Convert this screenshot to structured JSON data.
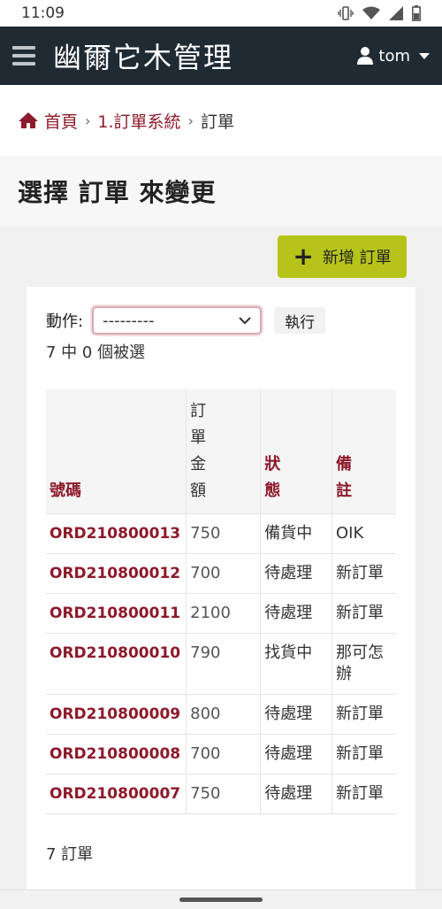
{
  "status_bar": {
    "time": "11:09"
  },
  "app_bar": {
    "title": "幽爾它木管理",
    "user": "tom"
  },
  "breadcrumbs": {
    "home": "首頁",
    "section": "1.訂單系統",
    "current": "訂單"
  },
  "page": {
    "title": "選擇 訂單 來變更",
    "add_button": "新增 訂單"
  },
  "actions": {
    "label": "動作:",
    "selected": "---------",
    "go_button": "執行",
    "counter": "7 中 0 個被選"
  },
  "table": {
    "headers": {
      "number": "號碼",
      "amount": "訂\n單\n金\n額",
      "status": "狀\n態",
      "note": "備\n註"
    },
    "rows": [
      {
        "id": "ORD210800013",
        "amount": "750",
        "status": "備貨中",
        "note": "OIK"
      },
      {
        "id": "ORD210800012",
        "amount": "700",
        "status": "待處理",
        "note": "新訂單"
      },
      {
        "id": "ORD210800011",
        "amount": "2100",
        "status": "待處理",
        "note": "新訂單"
      },
      {
        "id": "ORD210800010",
        "amount": "790",
        "status": "找貨中",
        "note": "那可怎\n辦"
      },
      {
        "id": "ORD210800009",
        "amount": "800",
        "status": "待處理",
        "note": "新訂單"
      },
      {
        "id": "ORD210800008",
        "amount": "700",
        "status": "待處理",
        "note": "新訂單"
      },
      {
        "id": "ORD210800007",
        "amount": "750",
        "status": "待處理",
        "note": "新訂單"
      }
    ]
  },
  "footer": {
    "count": "7 訂單"
  },
  "colors": {
    "header_bg": "#1f2a33",
    "link": "#8c1a2a",
    "add_button": "#b6c41a"
  }
}
